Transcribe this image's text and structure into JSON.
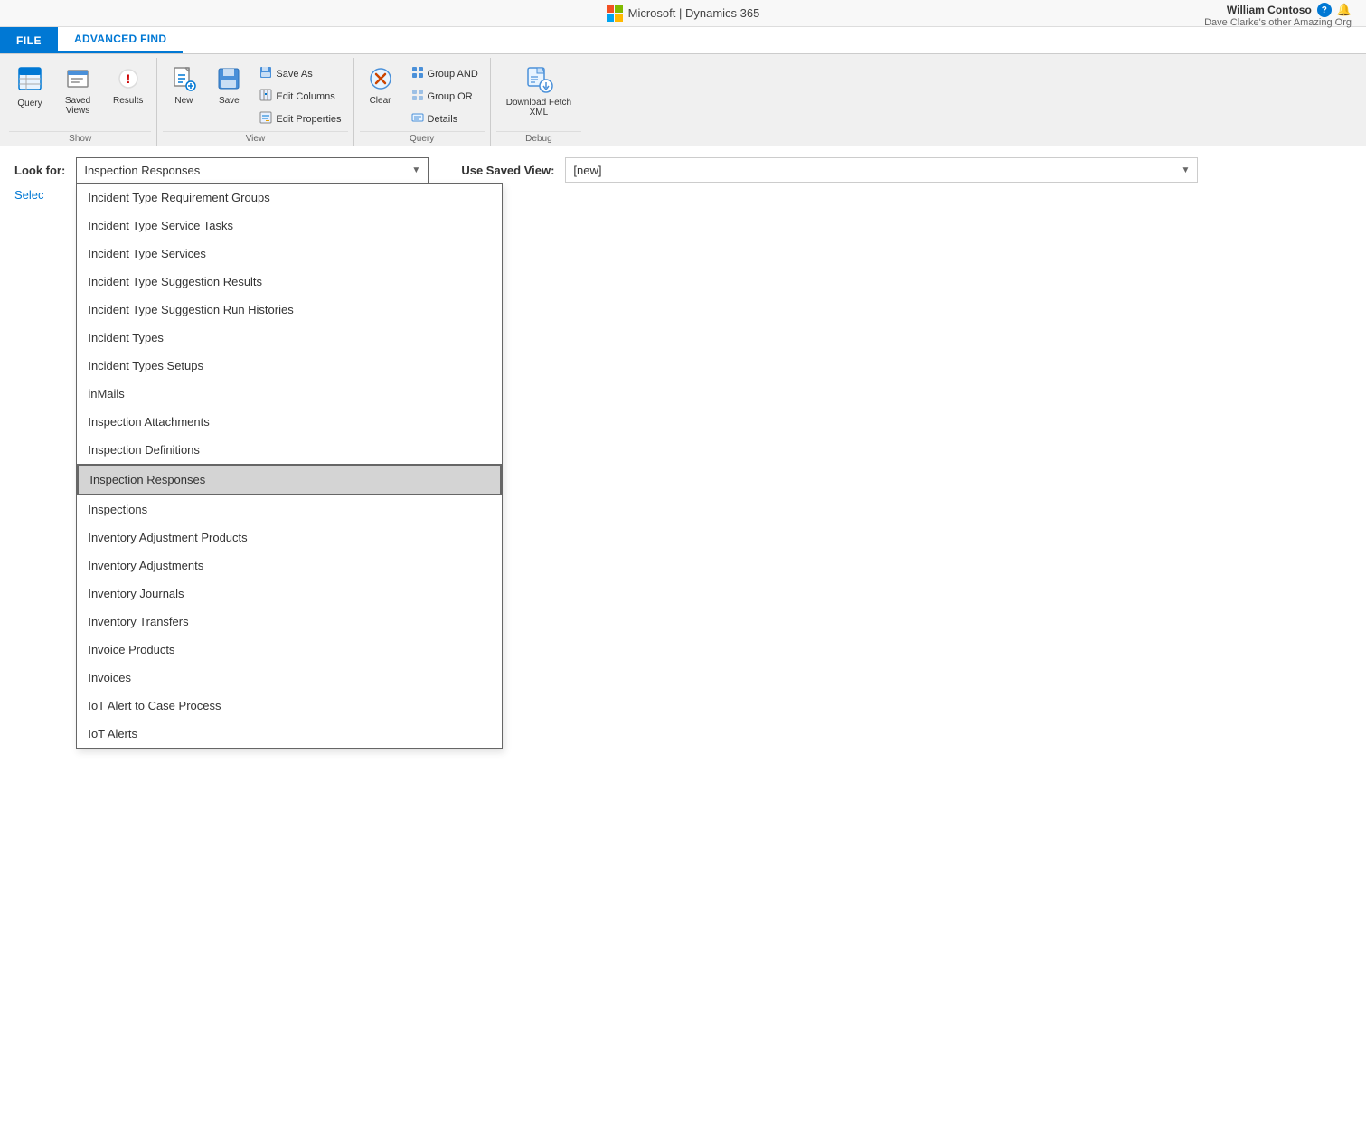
{
  "topbar": {
    "product": "Microsoft  |  Dynamics 365",
    "user_name": "William Contoso",
    "user_org": "Dave Clarke's other Amazing Org",
    "help_label": "?"
  },
  "ribbon": {
    "tabs": [
      {
        "id": "file",
        "label": "FILE",
        "active": true
      },
      {
        "id": "advanced-find",
        "label": "ADVANCED FIND",
        "active": false
      }
    ],
    "groups": {
      "show": {
        "label": "Show",
        "buttons": [
          {
            "id": "query",
            "label": "Query",
            "icon": "📋"
          },
          {
            "id": "saved-views",
            "label": "Saved\nViews",
            "icon": "📁"
          },
          {
            "id": "results",
            "label": "Results",
            "icon": "❗"
          }
        ]
      },
      "view": {
        "label": "View",
        "buttons_large": [
          {
            "id": "new",
            "label": "New",
            "icon": "📄"
          },
          {
            "id": "save",
            "label": "Save",
            "icon": "💾"
          }
        ],
        "buttons_small": [
          {
            "id": "save-as",
            "label": "Save As",
            "icon": "💾"
          },
          {
            "id": "edit-columns",
            "label": "Edit Columns",
            "icon": "✏️"
          },
          {
            "id": "edit-properties",
            "label": "Edit Properties",
            "icon": "✏️"
          }
        ]
      },
      "query": {
        "label": "Query",
        "buttons_large": [
          {
            "id": "clear",
            "label": "Clear",
            "icon": "🔄"
          }
        ],
        "buttons_small": [
          {
            "id": "group-and",
            "label": "Group AND",
            "icon": "📊"
          },
          {
            "id": "group-or",
            "label": "Group OR",
            "icon": "📊"
          },
          {
            "id": "details",
            "label": "Details",
            "icon": "📊"
          }
        ]
      },
      "debug": {
        "label": "Debug",
        "buttons": [
          {
            "id": "download-fetch-xml",
            "label": "Download Fetch\nXML",
            "icon": "⬇️"
          }
        ]
      }
    }
  },
  "lookfor": {
    "label": "Look for:",
    "selected_value": "Inspection Responses",
    "dropdown_arrow": "▼"
  },
  "saved_view": {
    "label": "Use Saved View:",
    "selected_value": "[new]"
  },
  "select_link": "Selec",
  "dropdown_items": [
    {
      "id": "incident-type-req-groups",
      "label": "Incident Type Requirement Groups",
      "selected": false
    },
    {
      "id": "incident-type-service-tasks",
      "label": "Incident Type Service Tasks",
      "selected": false
    },
    {
      "id": "incident-type-services",
      "label": "Incident Type Services",
      "selected": false
    },
    {
      "id": "incident-type-suggestion-results",
      "label": "Incident Type Suggestion Results",
      "selected": false
    },
    {
      "id": "incident-type-suggestion-run-histories",
      "label": "Incident Type Suggestion Run Histories",
      "selected": false
    },
    {
      "id": "incident-types",
      "label": "Incident Types",
      "selected": false
    },
    {
      "id": "incident-types-setups",
      "label": "Incident Types Setups",
      "selected": false
    },
    {
      "id": "inmails",
      "label": "inMails",
      "selected": false
    },
    {
      "id": "inspection-attachments",
      "label": "Inspection Attachments",
      "selected": false
    },
    {
      "id": "inspection-definitions",
      "label": "Inspection Definitions",
      "selected": false
    },
    {
      "id": "inspection-responses",
      "label": "Inspection Responses",
      "selected": true
    },
    {
      "id": "inspections",
      "label": "Inspections",
      "selected": false
    },
    {
      "id": "inventory-adjustment-products",
      "label": "Inventory Adjustment Products",
      "selected": false
    },
    {
      "id": "inventory-adjustments",
      "label": "Inventory Adjustments",
      "selected": false
    },
    {
      "id": "inventory-journals",
      "label": "Inventory Journals",
      "selected": false
    },
    {
      "id": "inventory-transfers",
      "label": "Inventory Transfers",
      "selected": false
    },
    {
      "id": "invoice-products",
      "label": "Invoice Products",
      "selected": false
    },
    {
      "id": "invoices",
      "label": "Invoices",
      "selected": false
    },
    {
      "id": "iot-alert-to-case-process",
      "label": "IoT Alert to Case Process",
      "selected": false
    },
    {
      "id": "iot-alerts",
      "label": "IoT Alerts",
      "selected": false
    }
  ],
  "colors": {
    "accent_blue": "#0078d4",
    "ribbon_bg": "#f0f0f0",
    "tab_active_bg": "#0078d4",
    "tab_active_text": "#ffffff",
    "selected_item_bg": "#e0e0e0"
  }
}
